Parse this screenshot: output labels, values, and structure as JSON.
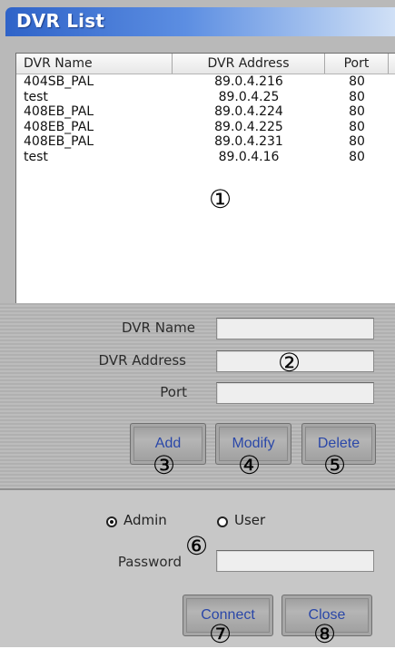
{
  "window": {
    "title": "DVR List"
  },
  "list": {
    "columns": [
      "DVR Name",
      "DVR Address",
      "Port"
    ],
    "rows": [
      {
        "name": "404SB_PAL",
        "address": "89.0.4.216",
        "port": "80"
      },
      {
        "name": "test",
        "address": "89.0.4.25",
        "port": "80"
      },
      {
        "name": "408EB_PAL",
        "address": "89.0.4.224",
        "port": "80"
      },
      {
        "name": "408EB_PAL",
        "address": "89.0.4.225",
        "port": "80"
      },
      {
        "name": "408EB_PAL",
        "address": "89.0.4.231",
        "port": "80"
      },
      {
        "name": "test",
        "address": "89.0.4.16",
        "port": "80"
      }
    ]
  },
  "form": {
    "name_label": "DVR Name",
    "name_value": "",
    "address_label": "DVR Address",
    "address_value": "",
    "port_label": "Port",
    "port_value": "",
    "add_label": "Add",
    "modify_label": "Modify",
    "delete_label": "Delete"
  },
  "login": {
    "role_options": [
      "Admin",
      "User"
    ],
    "selected_role": "Admin",
    "password_label": "Password",
    "password_value": "",
    "connect_label": "Connect",
    "close_label": "Close"
  },
  "markers": [
    "①",
    "②",
    "③",
    "④",
    "⑤",
    "⑥",
    "⑦",
    "⑧"
  ]
}
